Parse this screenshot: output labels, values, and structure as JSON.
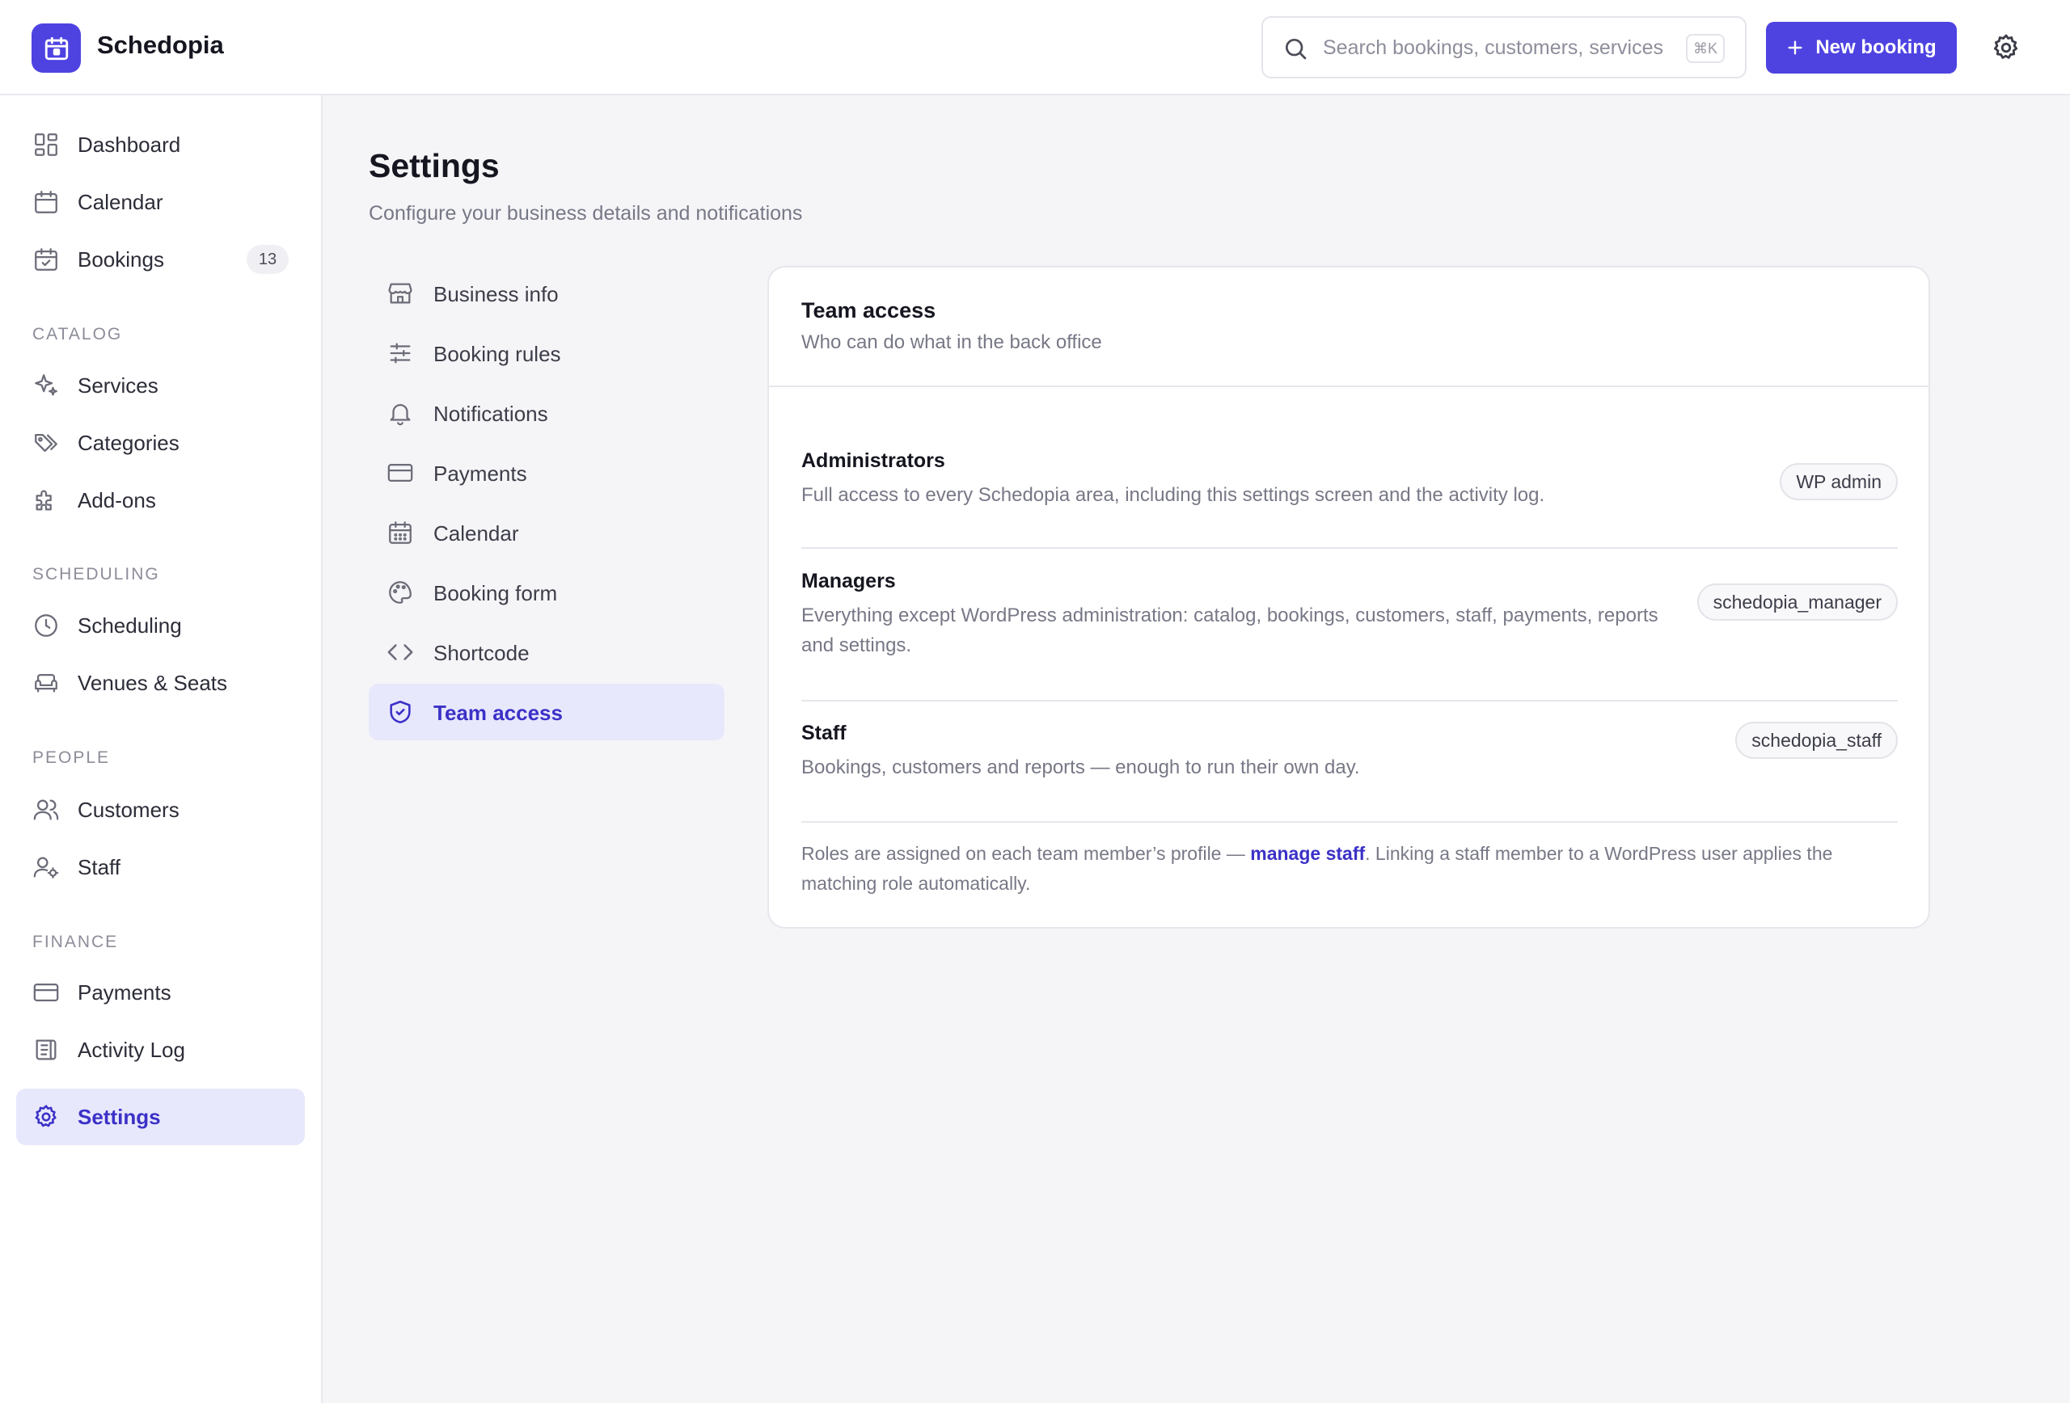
{
  "brand": {
    "name": "Schedopia",
    "accent": "#4e43e1"
  },
  "search": {
    "placeholder": "Search bookings, customers, services",
    "shortcut": "⌘K"
  },
  "header": {
    "new_booking_label": "New booking"
  },
  "sidebar": {
    "top_items": [
      {
        "label": "Dashboard",
        "icon": "dashboard-icon"
      },
      {
        "label": "Calendar",
        "icon": "calendar-icon"
      },
      {
        "label": "Bookings",
        "icon": "calendar-check-icon",
        "badge": "13"
      }
    ],
    "sections": [
      {
        "title": "CATALOG",
        "items": [
          {
            "label": "Services",
            "icon": "sparkles-icon"
          },
          {
            "label": "Categories",
            "icon": "tags-icon"
          },
          {
            "label": "Add-ons",
            "icon": "puzzle-icon"
          }
        ]
      },
      {
        "title": "SCHEDULING",
        "items": [
          {
            "label": "Scheduling",
            "icon": "clock-icon"
          },
          {
            "label": "Venues & Seats",
            "icon": "sofa-icon"
          }
        ]
      },
      {
        "title": "PEOPLE",
        "items": [
          {
            "label": "Customers",
            "icon": "users-icon"
          },
          {
            "label": "Staff",
            "icon": "user-gear-icon"
          }
        ]
      },
      {
        "title": "FINANCE",
        "items": [
          {
            "label": "Payments",
            "icon": "credit-card-icon"
          },
          {
            "label": "Activity Log",
            "icon": "scroll-icon"
          }
        ]
      }
    ],
    "settings_item": {
      "label": "Settings",
      "icon": "gear-icon",
      "active": true
    }
  },
  "page": {
    "title": "Settings",
    "subtitle": "Configure your business details and notifications"
  },
  "settings_nav": [
    {
      "label": "Business info",
      "icon": "store-icon"
    },
    {
      "label": "Booking rules",
      "icon": "sliders-icon"
    },
    {
      "label": "Notifications",
      "icon": "bell-icon"
    },
    {
      "label": "Payments",
      "icon": "credit-card-icon"
    },
    {
      "label": "Calendar",
      "icon": "calendar-icon"
    },
    {
      "label": "Booking form",
      "icon": "palette-icon"
    },
    {
      "label": "Shortcode",
      "icon": "code-icon"
    },
    {
      "label": "Team access",
      "icon": "shield-check-icon",
      "active": true
    }
  ],
  "team_access": {
    "title": "Team access",
    "subtitle": "Who can do what in the back office",
    "roles": [
      {
        "name": "Administrators",
        "description": "Full access to every Schedopia area, including this settings screen and the activity log.",
        "role_tag": "WP admin"
      },
      {
        "name": "Managers",
        "description": "Everything except WordPress administration: catalog, bookings, customers, staff, payments, reports and settings.",
        "role_tag": "schedopia_manager"
      },
      {
        "name": "Staff",
        "description": "Bookings, customers and reports — enough to run their own day.",
        "role_tag": "schedopia_staff"
      }
    ],
    "footer_before": "Roles are assigned on each team member’s profile — ",
    "footer_link": "manage staff",
    "footer_after": ". Linking a staff member to a WordPress user applies the matching role automatically."
  }
}
